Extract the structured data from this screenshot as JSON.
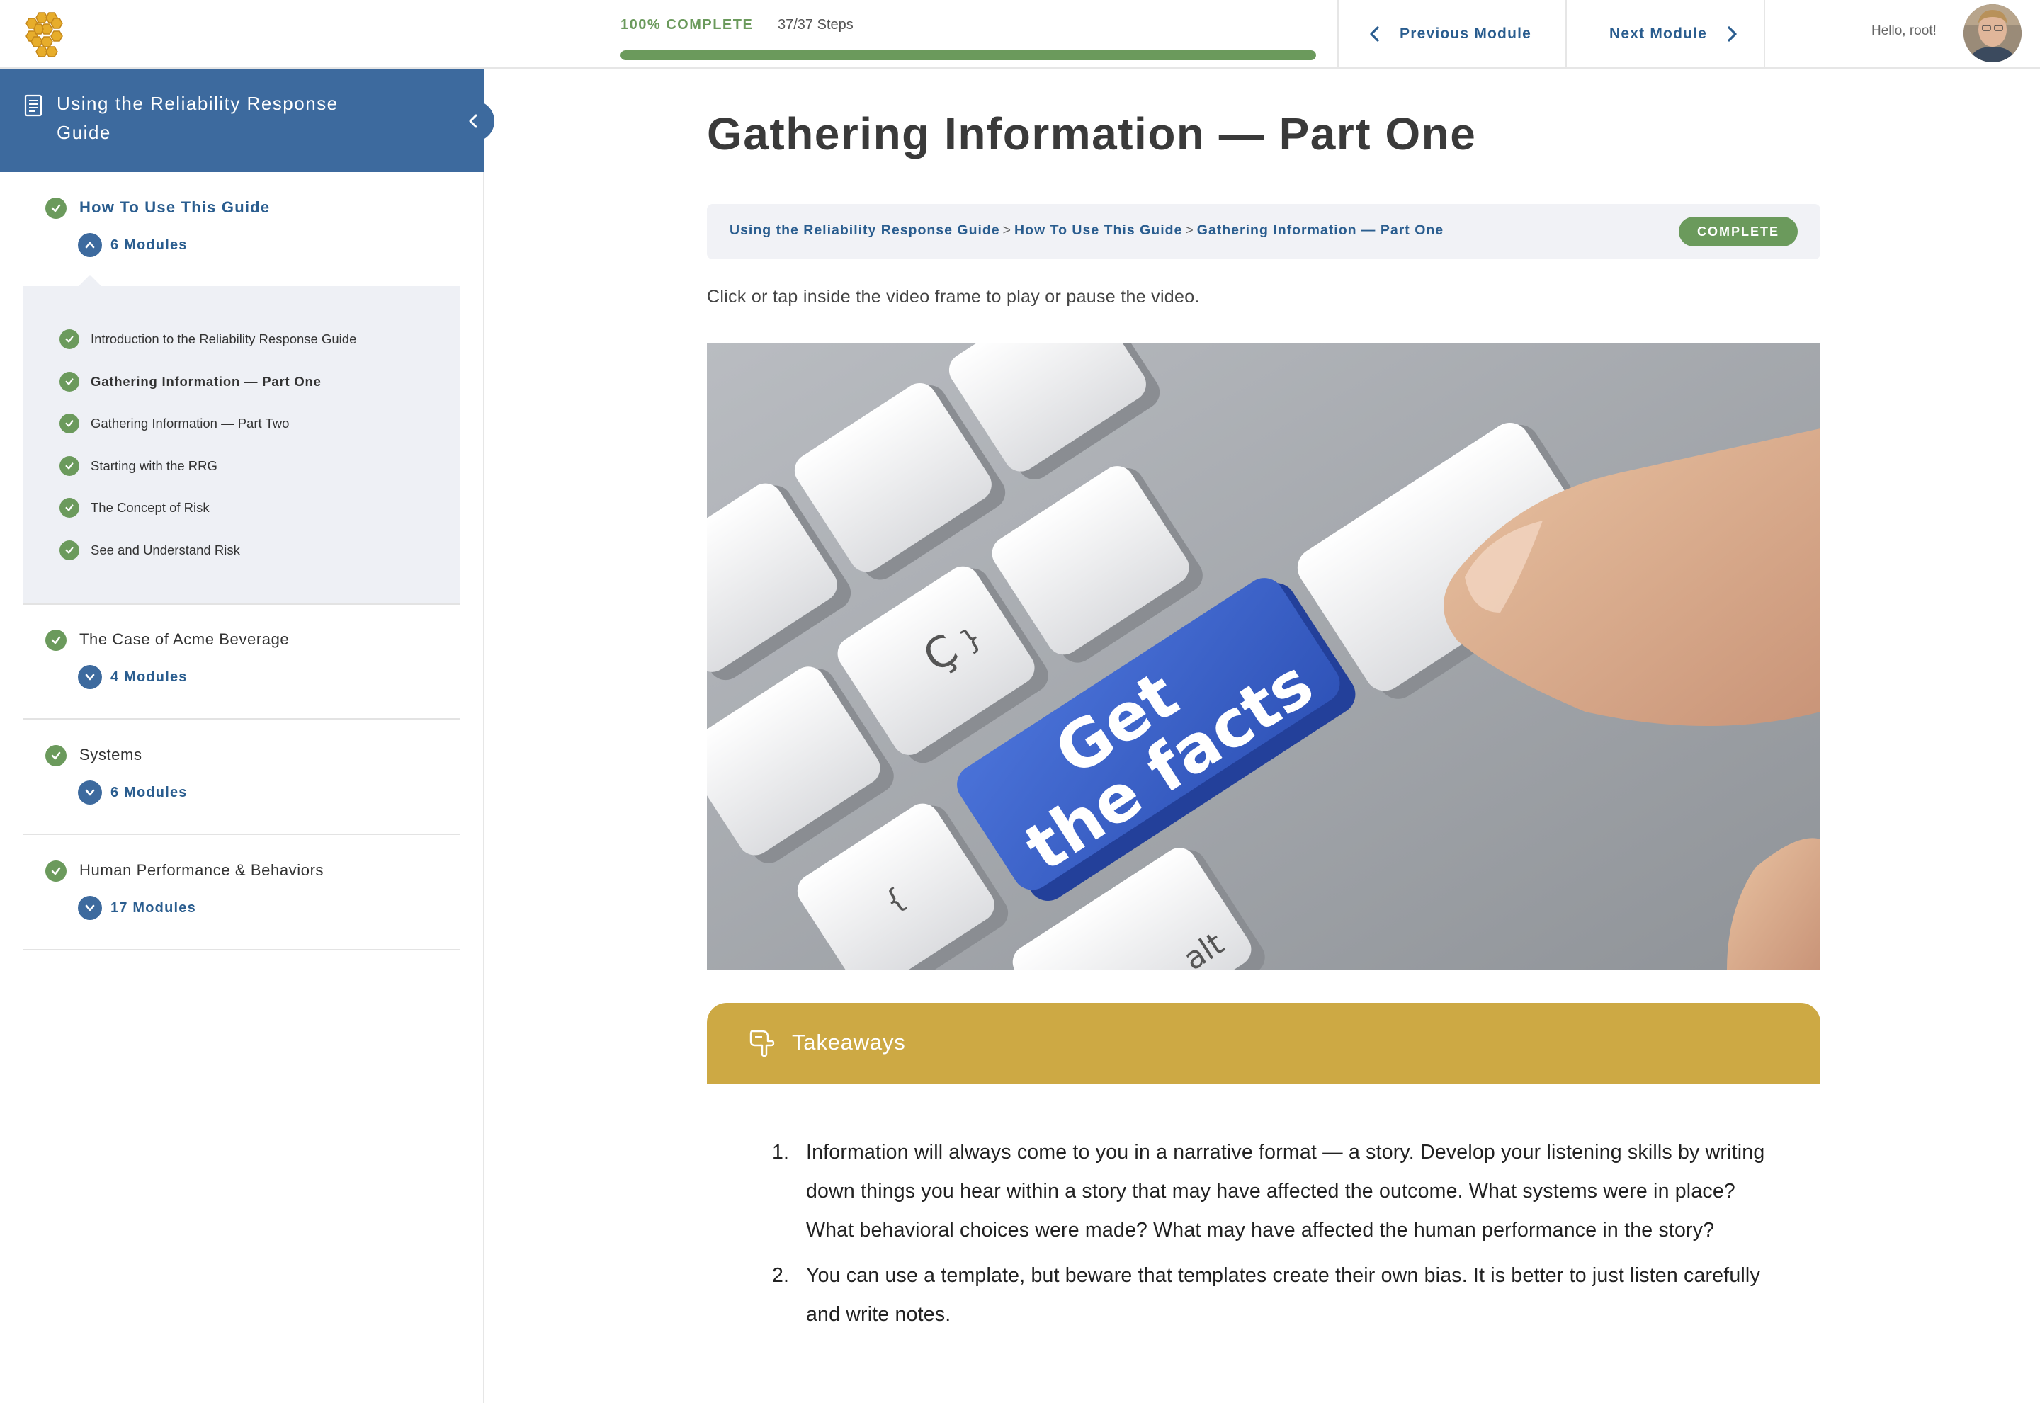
{
  "topbar": {
    "progress_label": "100% COMPLETE",
    "steps_label": "37/37 Steps",
    "progress_fraction": 1.0,
    "prev_label": "Previous Module",
    "next_label": "Next Module",
    "greeting": "Hello, root!"
  },
  "sidebar": {
    "course_title": "Using the Reliability Response Guide",
    "lessons": [
      {
        "title": "How To Use This Guide",
        "modules": "6 Modules",
        "expanded": true,
        "topics": [
          {
            "label": "Introduction to the Reliability Response Guide"
          },
          {
            "label": "Gathering Information — Part One",
            "current": true
          },
          {
            "label": "Gathering Information — Part Two"
          },
          {
            "label": "Starting with the RRG"
          },
          {
            "label": "The Concept of Risk"
          },
          {
            "label": "See and Understand Risk"
          }
        ]
      },
      {
        "title": "The Case of Acme Beverage",
        "modules": "4 Modules"
      },
      {
        "title": "Systems",
        "modules": "6 Modules"
      },
      {
        "title": "Human Performance & Behaviors",
        "modules": "17 Modules"
      }
    ]
  },
  "main": {
    "title": "Gathering Information — Part One",
    "breadcrumbs": [
      "Using the Reliability Response Guide",
      "How To Use This Guide",
      "Gathering Information — Part One"
    ],
    "breadcrumb_separator": ">",
    "status_badge": "COMPLETE",
    "instruction": "Click or tap inside the video frame to play or pause the video.",
    "video_key_text": [
      "Get",
      "the facts"
    ],
    "keyboard_keys": [
      "ctrl",
      "alt"
    ],
    "takeaways_title": "Takeaways",
    "takeaways": [
      {
        "num": "1.",
        "text": "Information will always come to you in a narrative format — a story. Develop your listening skills by writing down things you hear within a story that may have affected the outcome. What systems were in place? What behavioral choices were made? What may have affected the human performance in the story?"
      },
      {
        "num": "2.",
        "text": "You can use a template, but beware that templates create their own bias. It is better to just listen carefully and write notes."
      }
    ]
  },
  "colors": {
    "accent_blue": "#3d6a9e",
    "link_blue": "#2a5d8f",
    "success_green": "#6b9a5c",
    "takeaways_gold": "#cda944",
    "key_blue": "#3f63c9"
  }
}
